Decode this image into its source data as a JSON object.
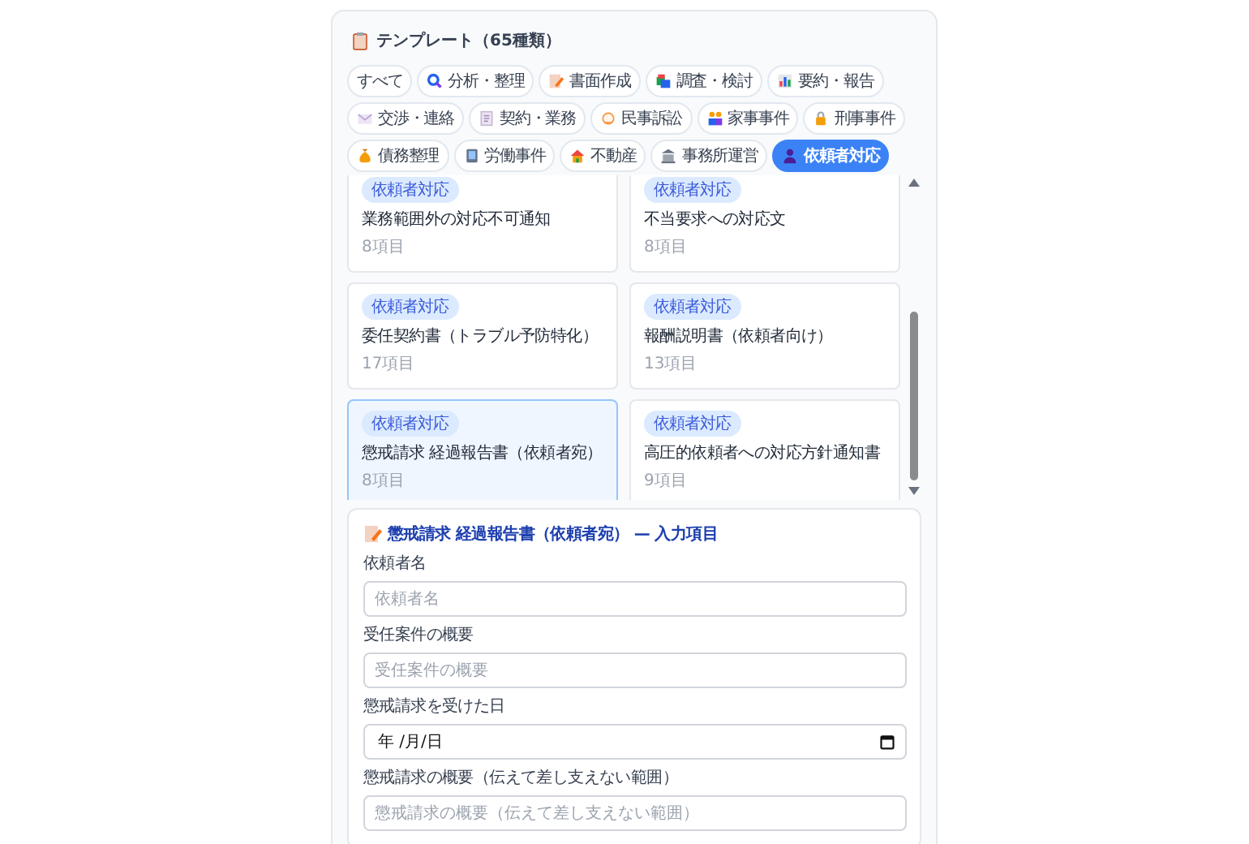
{
  "panel": {
    "title": "テンプレート（65種類）"
  },
  "categories": [
    {
      "label": "すべて",
      "selected": false
    },
    {
      "label": "分析・整理",
      "selected": false
    },
    {
      "label": "書面作成",
      "selected": false
    },
    {
      "label": "調査・検討",
      "selected": false
    },
    {
      "label": "要約・報告",
      "selected": false
    },
    {
      "label": "交渉・連絡",
      "selected": false
    },
    {
      "label": "契約・業務",
      "selected": false
    },
    {
      "label": "民事訴訟",
      "selected": false
    },
    {
      "label": "家事事件",
      "selected": false
    },
    {
      "label": "刑事事件",
      "selected": false
    },
    {
      "label": "債務整理",
      "selected": false
    },
    {
      "label": "労働事件",
      "selected": false
    },
    {
      "label": "不動産",
      "selected": false
    },
    {
      "label": "事務所運営",
      "selected": false
    },
    {
      "label": "依頼者対応",
      "selected": true
    }
  ],
  "templates": [
    {
      "tag": "依頼者対応",
      "title": "業務範囲外の対応不可通知",
      "count": "8項目",
      "selected": false
    },
    {
      "tag": "依頼者対応",
      "title": "不当要求への対応文",
      "count": "8項目",
      "selected": false
    },
    {
      "tag": "依頼者対応",
      "title": "委任契約書（トラブル予防特化）",
      "count": "17項目",
      "selected": false
    },
    {
      "tag": "依頼者対応",
      "title": "報酬説明書（依頼者向け）",
      "count": "13項目",
      "selected": false
    },
    {
      "tag": "依頼者対応",
      "title": "懲戒請求 経過報告書（依頼者宛）",
      "count": "8項目",
      "selected": true
    },
    {
      "tag": "依頼者対応",
      "title": "高圧的依頼者への対応方針通知書",
      "count": "9項目",
      "selected": false
    }
  ],
  "form": {
    "title": "懲戒請求 経過報告書（依頼者宛） — 入力項目",
    "fields": [
      {
        "label": "依頼者名",
        "kind": "text",
        "placeholder": "依頼者名"
      },
      {
        "label": "受任案件の概要",
        "kind": "text",
        "placeholder": "受任案件の概要"
      },
      {
        "label": "懲戒請求を受けた日",
        "kind": "date",
        "value": "年 /月/日"
      },
      {
        "label": "懲戒請求の概要（伝えて差し支えない範囲）",
        "kind": "text",
        "placeholder": "懲戒請求の概要（伝えて差し支えない範囲）"
      }
    ]
  }
}
